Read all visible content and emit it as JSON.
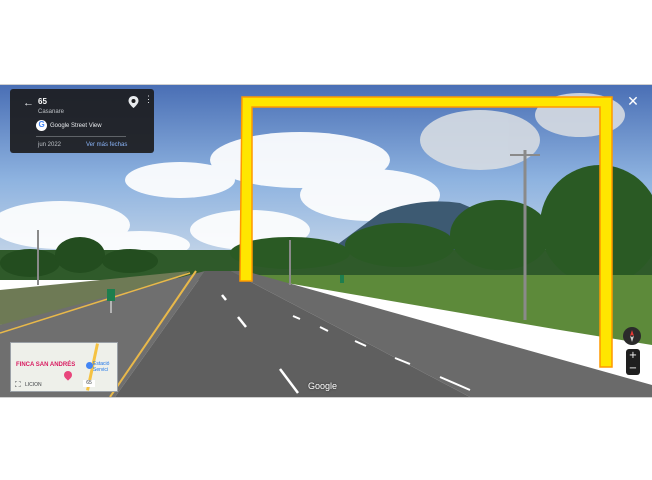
{
  "header": {
    "back_icon": "arrow-left-icon",
    "title": "65",
    "subtitle": "Casanare",
    "pin_icon": "location-pin-icon",
    "more_icon": "more-vert-icon"
  },
  "street_view": {
    "logo_letter": "G",
    "label": "Google Street View",
    "date": "jun 2022",
    "more_dates": "Ver más fechas"
  },
  "controls": {
    "close_icon": "close-icon",
    "close_glyph": "✕",
    "compass_icon": "compass-icon",
    "zoom_in": "+",
    "zoom_out": "−"
  },
  "minimap": {
    "place_label": "FINCA SAN ANDRÉS",
    "poi_label_1": "Estació",
    "poi_label_2": "Servici",
    "bottom_label": "LICION",
    "road_badge": "65",
    "expand_icon": "fullscreen-icon"
  },
  "watermark": "Google",
  "overlay": {
    "highlight_color": "#ffe600",
    "highlight_edge": "#ff9900"
  }
}
